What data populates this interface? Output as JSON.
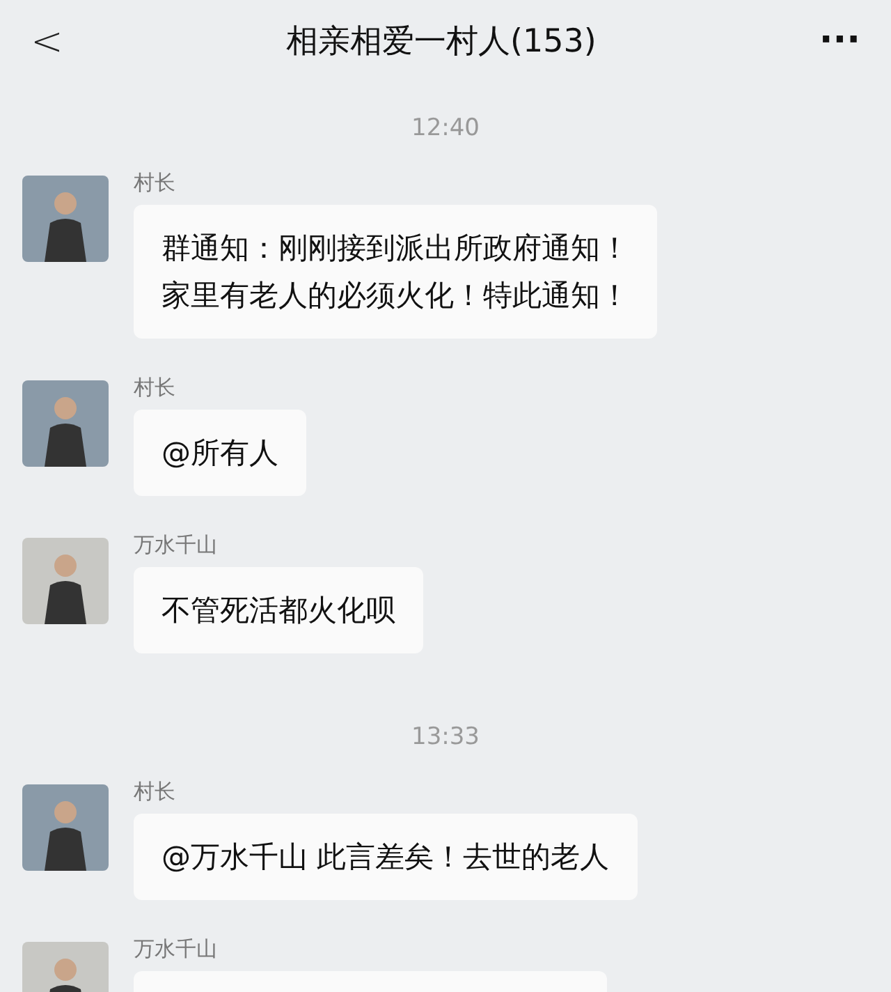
{
  "header": {
    "back": "<",
    "title": "相亲相爱一村人(153)",
    "more": "···"
  },
  "items": [
    {
      "kind": "time",
      "text": "12:40"
    },
    {
      "kind": "message",
      "sender": "村长",
      "color": "#8a9aa8",
      "lines": [
        "群通知：刚刚接到派出所政府通知！",
        "家里有老人的必须火化！特此通知！"
      ]
    },
    {
      "kind": "message",
      "sender": "村长",
      "color": "#8a9aa8",
      "lines": [
        "@所有人"
      ]
    },
    {
      "kind": "message",
      "sender": "万水千山",
      "color": "#c8c8c4",
      "lines": [
        "不管死活都火化呗"
      ]
    },
    {
      "kind": "time",
      "text": "13:33"
    },
    {
      "kind": "message",
      "sender": "村长",
      "color": "#8a9aa8",
      "lines": [
        "@万水千山 此言差矣！去世的老人"
      ]
    },
    {
      "kind": "message",
      "sender": "万水千山",
      "color": "#c8c8c4"
    }
  ]
}
